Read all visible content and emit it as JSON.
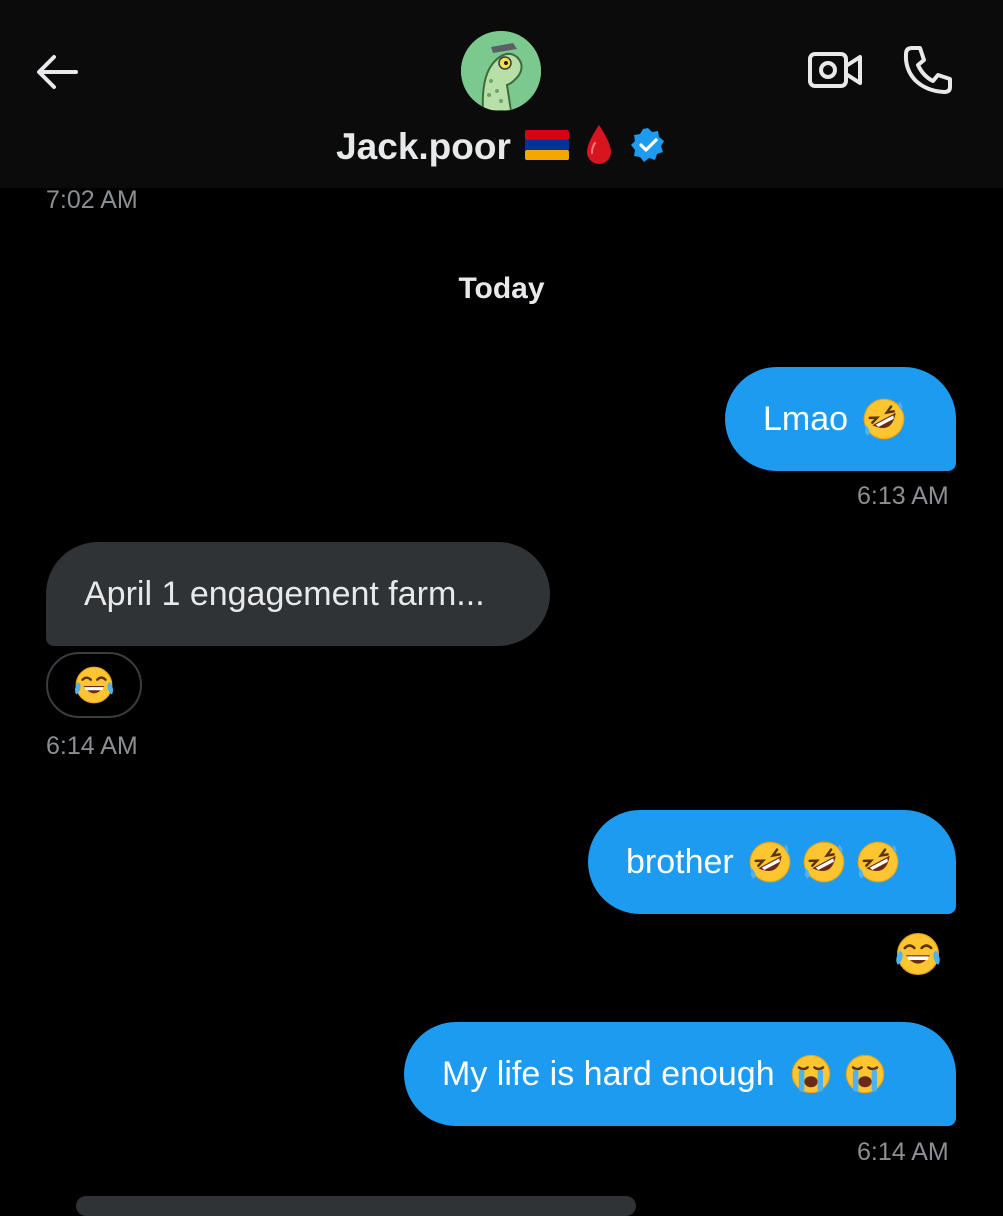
{
  "header": {
    "contact_name": "Jack.poor",
    "verified": true,
    "icons": [
      "back-arrow-icon",
      "video-call-icon",
      "phone-icon",
      "armenia-flag-icon",
      "blood-drop-icon",
      "verified-badge-icon"
    ]
  },
  "colors": {
    "background": "#000000",
    "header_bg": "#0b0b0b",
    "sent_bubble": "#1d9bf0",
    "received_bubble": "#2f3336",
    "timestamp": "#8b8f94",
    "verified": "#1d9bf0"
  },
  "conversation": {
    "previous_timestamp": "7:02 AM",
    "day_divider": "Today",
    "messages": [
      {
        "direction": "sent",
        "text": "Lmao",
        "emojis": [
          "rolling-on-floor-laughing"
        ],
        "time": "6:13 AM"
      },
      {
        "direction": "received",
        "text": "April 1 engagement farm...",
        "reaction": "face-with-tears-of-joy",
        "time": "6:14 AM"
      },
      {
        "direction": "sent",
        "text": "brother",
        "emojis": [
          "rolling-on-floor-laughing",
          "rolling-on-floor-laughing",
          "rolling-on-floor-laughing"
        ],
        "reaction": "face-with-tears-of-joy"
      },
      {
        "direction": "sent",
        "text": "My life is hard enough",
        "emojis": [
          "loudly-crying-face",
          "loudly-crying-face"
        ],
        "time": "6:14 AM"
      }
    ]
  }
}
